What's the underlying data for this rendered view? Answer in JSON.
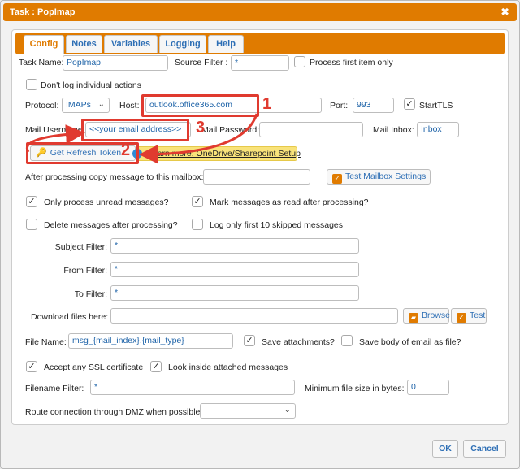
{
  "window": {
    "title": "Task : PopImap",
    "close_icon": "✖"
  },
  "tabs": [
    {
      "label": "Config",
      "active": true
    },
    {
      "label": "Notes"
    },
    {
      "label": "Variables"
    },
    {
      "label": "Logging"
    },
    {
      "label": "Help"
    }
  ],
  "form": {
    "task_name_label": "Task Name:",
    "task_name_value": "PopImap",
    "source_filter_label": "Source Filter :",
    "source_filter_value": "*",
    "process_first_label": "Process first item only",
    "dont_log_label": "Don't log individual actions",
    "protocol_label": "Protocol:",
    "protocol_value": "IMAPs",
    "host_label": "Host:",
    "host_value": "outlook.office365.com",
    "port_label": "Port:",
    "port_value": "993",
    "starttls_label": "StartTLS",
    "mail_username_label": "Mail Username:",
    "mail_username_value": "<<your email address>>",
    "mail_password_label": "Mail Password:",
    "mail_inbox_label": "Mail Inbox:",
    "mail_inbox_value": "Inbox",
    "refresh_token_label": "Get Refresh Token",
    "learn_more_label": "Learn more: OneDrive/Sharepoint Setup",
    "copy_message_label": "After processing copy message to this mailbox:",
    "test_mailbox_label": "Test Mailbox Settings",
    "only_unread_label": "Only process unread messages?",
    "mark_read_label": "Mark messages as read after processing?",
    "delete_after_label": "Delete messages after processing?",
    "log_skipped_label": "Log only first 10 skipped messages",
    "subject_filter_label": "Subject Filter:",
    "subject_filter_value": "*",
    "from_filter_label": "From Filter:",
    "from_filter_value": "*",
    "to_filter_label": "To Filter:",
    "to_filter_value": "*",
    "download_label": "Download files here:",
    "browse_label": "Browse",
    "test_label": "Test",
    "file_name_label": "File Name:",
    "file_name_value": "msg_{mail_index}.{mail_type}",
    "save_attachments_label": "Save attachments?",
    "save_body_label": "Save body of email as file?",
    "accept_ssl_label": "Accept any SSL certificate",
    "look_inside_label": "Look inside attached messages",
    "filename_filter_label": "Filename Filter:",
    "filename_filter_value": "*",
    "min_size_label": "Minimum file size in bytes:",
    "min_size_value": "0",
    "route_dmz_label": "Route connection through DMZ when possible:"
  },
  "annotations": {
    "one": "1",
    "two": "2",
    "three": "3"
  },
  "footer": {
    "ok_label": "OK",
    "cancel_label": "Cancel"
  },
  "colors": {
    "accent": "#e07b00",
    "annotation": "#e03a2f",
    "link": "#2e6fb5"
  }
}
